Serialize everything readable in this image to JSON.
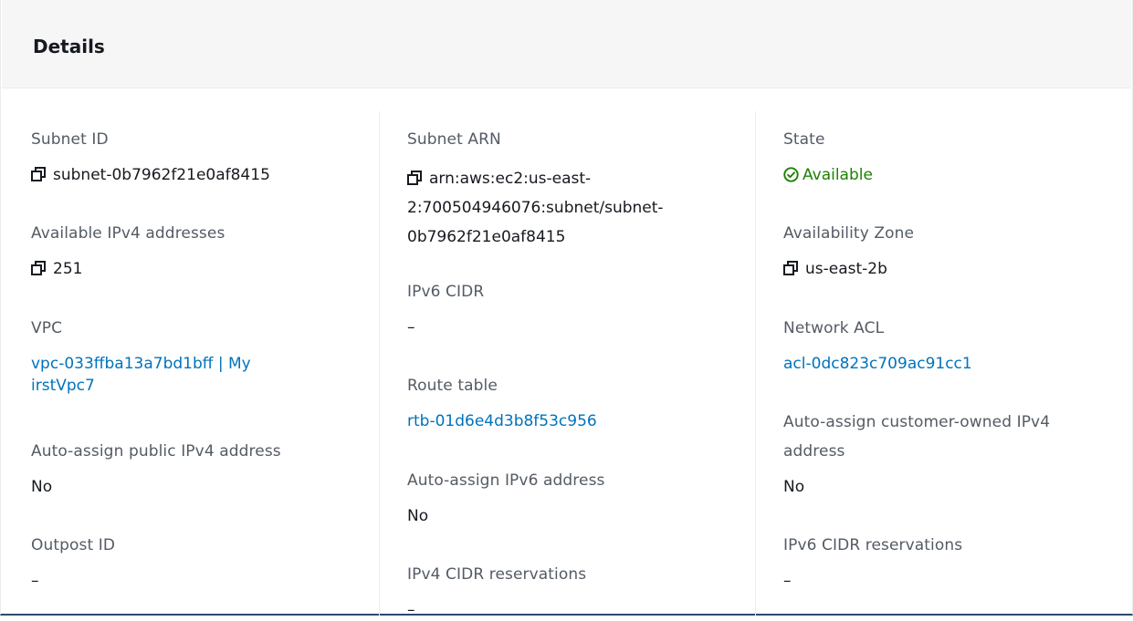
{
  "header": {
    "title": "Details"
  },
  "col1": {
    "subnet_id_label": "Subnet ID",
    "subnet_id_value": "subnet-0b7962f21e0af8415",
    "available_ipv4_label": "Available IPv4 addresses",
    "available_ipv4_value": "251",
    "vpc_label": "VPC",
    "vpc_value_line1": "vpc-033ffba13a7bd1bff | My",
    "vpc_value_line2": "irstVpc7",
    "auto_public_ipv4_label": "Auto-assign public IPv4 address",
    "auto_public_ipv4_value": "No",
    "outpost_id_label": "Outpost ID",
    "outpost_id_value": "–"
  },
  "col2": {
    "subnet_arn_label": "Subnet ARN",
    "subnet_arn_line1": "arn:aws:ec2:us-east-",
    "subnet_arn_line2": "2:700504946076:subnet/subnet-",
    "subnet_arn_line3": "0b7962f21e0af8415",
    "ipv6_cidr_label": "IPv6 CIDR",
    "ipv6_cidr_value": "–",
    "route_table_label": "Route table",
    "route_table_value": "rtb-01d6e4d3b8f53c956",
    "auto_ipv6_label": "Auto-assign IPv6 address",
    "auto_ipv6_value": "No",
    "ipv4_cidr_res_label": "IPv4 CIDR reservations",
    "ipv4_cidr_res_value": "–"
  },
  "col3": {
    "state_label": "State",
    "state_value": "Available",
    "az_label": "Availability Zone",
    "az_value": "us-east-2b",
    "nacl_label": "Network ACL",
    "nacl_value": "acl-0dc823c709ac91cc1",
    "auto_coip_label_line1": "Auto-assign customer-owned IPv4",
    "auto_coip_label_line2": "address",
    "auto_coip_value": "No",
    "ipv6_cidr_res_label": "IPv6 CIDR reservations",
    "ipv6_cidr_res_value": "–"
  },
  "colors": {
    "link": "#0073bb",
    "success": "#1d8102",
    "label": "#545b64",
    "text": "#16191f"
  },
  "icons": [
    "copy-icon",
    "status-available-icon"
  ]
}
